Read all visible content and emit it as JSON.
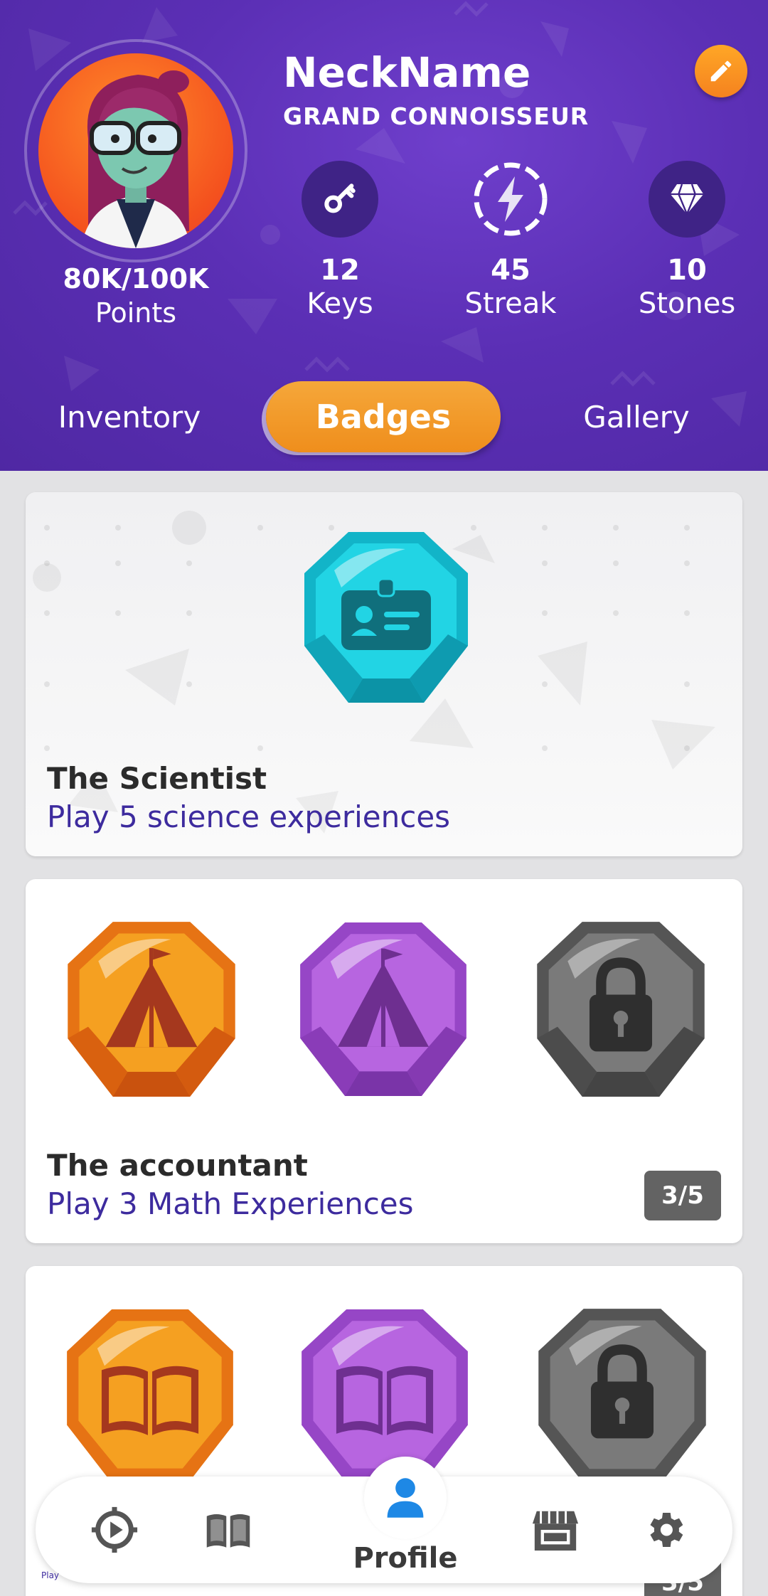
{
  "colors": {
    "header_bg": "#5b2fb5",
    "accent_orange": "#ef8e1c",
    "stat_circle": "#3f2386",
    "desc_text": "#3d2b9e",
    "progress_bg": "#636363",
    "profile_blue": "#1e88e5"
  },
  "profile": {
    "nickname": "NeckName",
    "title": "GRAND CONNOISSEUR",
    "points_value": "80K/100K",
    "points_label": "Points",
    "edit_icon": "pencil-icon"
  },
  "stats": [
    {
      "icon": "key-icon",
      "value": "12",
      "label": "Keys"
    },
    {
      "icon": "lightning-icon",
      "value": "45",
      "label": "Streak"
    },
    {
      "icon": "diamond-icon",
      "value": "10",
      "label": "Stones"
    }
  ],
  "tabs": [
    {
      "label": "Inventory",
      "active": false
    },
    {
      "label": "Badges",
      "active": true
    },
    {
      "label": "Gallery",
      "active": false
    }
  ],
  "badges": [
    {
      "name": "The Scientist",
      "description": "Play 5 science experiences",
      "gems": [
        {
          "color": "teal",
          "icon": "id-card-icon",
          "locked": false
        }
      ]
    },
    {
      "name": "The accountant",
      "description": "Play 3 Math Experiences",
      "progress": "3/5",
      "gems": [
        {
          "color": "orange",
          "icon": "tent-icon",
          "locked": false
        },
        {
          "color": "purple",
          "icon": "tent-icon",
          "locked": false
        },
        {
          "color": "gray",
          "icon": "lock-icon",
          "locked": true
        }
      ]
    },
    {
      "name": "",
      "description": "",
      "progress": "3/5",
      "gems": [
        {
          "color": "orange",
          "icon": "book-icon",
          "locked": false
        },
        {
          "color": "purple",
          "icon": "book-icon",
          "locked": false
        },
        {
          "color": "gray",
          "icon": "lock-icon",
          "locked": true
        }
      ]
    }
  ],
  "bottom_nav": {
    "items": [
      {
        "icon": "compass-target-icon"
      },
      {
        "icon": "book-open-icon"
      },
      {
        "icon": "person-icon",
        "label": "Profile",
        "active": true
      },
      {
        "icon": "store-icon"
      },
      {
        "icon": "gear-icon"
      }
    ],
    "tiny_text": "Play"
  }
}
